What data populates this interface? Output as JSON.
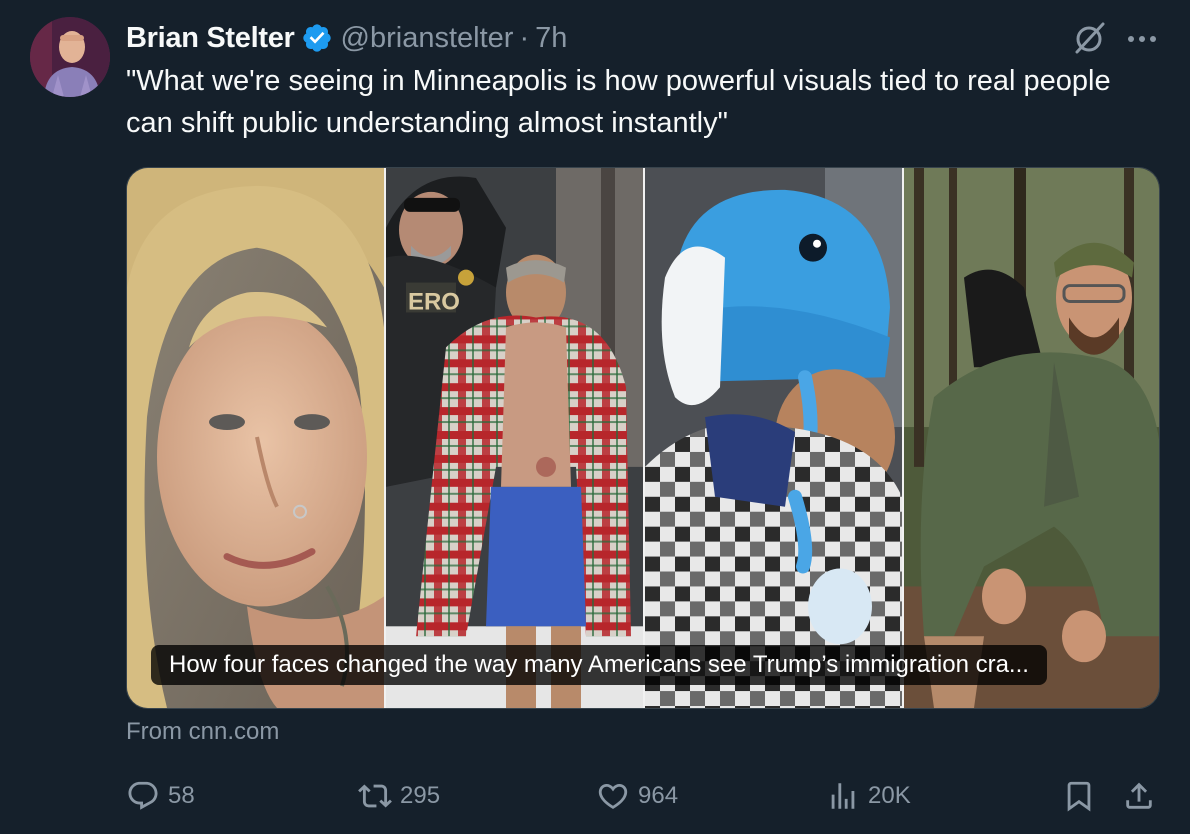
{
  "author": {
    "name": "Brian Stelter",
    "handle": "@brianstelter",
    "separator": "·",
    "time": "7h",
    "verified_color": "#1d9bf0"
  },
  "tweet": {
    "text": "\"What we're seeing in Minneapolis is how powerful visuals tied to real people can shift public understanding almost instantly\""
  },
  "card": {
    "caption": "How four faces changed the way many Americans see Trump’s immigration cra...",
    "source": "From cnn.com",
    "panel_text": "ERO"
  },
  "actions": {
    "replies": "58",
    "reposts": "295",
    "likes": "964",
    "views": "20K"
  },
  "icons": {
    "grok": "grok-icon",
    "more": "more-icon",
    "reply": "reply-icon",
    "repost": "repost-icon",
    "like": "heart-icon",
    "views": "views-icon",
    "bookmark": "bookmark-icon",
    "share": "share-icon"
  },
  "colors": {
    "background": "#15202b",
    "text": "#f7f9f9",
    "muted": "#8b98a5",
    "border": "#38444d",
    "accent": "#1d9bf0"
  }
}
